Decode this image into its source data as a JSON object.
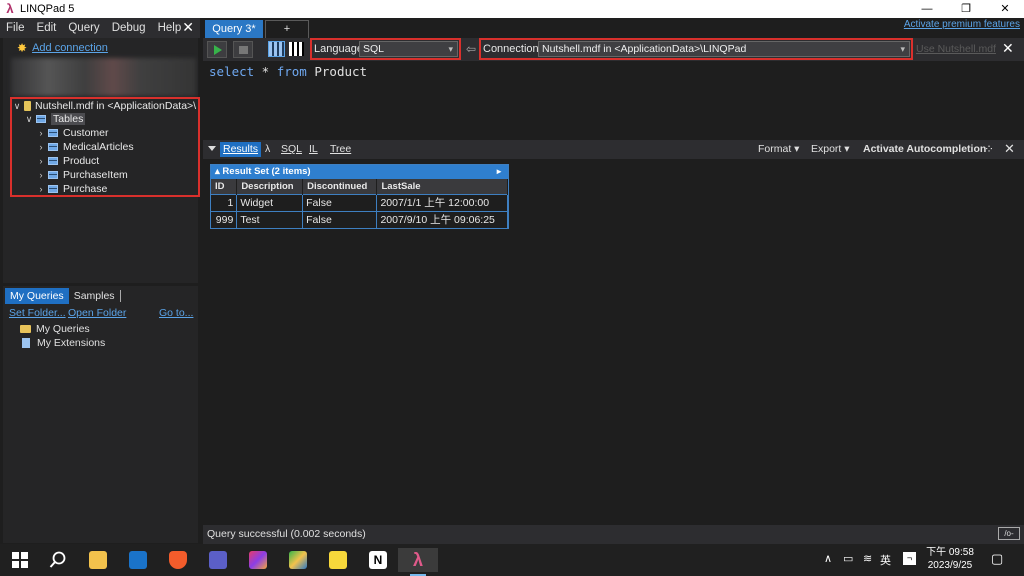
{
  "window": {
    "title": "LINQPad 5",
    "minimize": "—",
    "maximize": "❐",
    "close": "✕"
  },
  "menu": {
    "items": [
      "File",
      "Edit",
      "Query",
      "Debug",
      "Help"
    ],
    "close": "✕"
  },
  "connections": {
    "add_connection": "Add connection",
    "database": "Nutshell.mdf in <ApplicationData>\\",
    "tables_label": "Tables",
    "tables": [
      "Customer",
      "MedicalArticles",
      "Product",
      "PurchaseItem",
      "Purchase"
    ]
  },
  "queries_panel": {
    "tabs": [
      "My Queries",
      "Samples"
    ],
    "set_folder": "Set Folder...",
    "open_folder": "Open Folder",
    "go_to": "Go to...",
    "items": [
      "My Queries",
      "My Extensions"
    ]
  },
  "query_tabs": {
    "active": "Query 3*",
    "add": "+",
    "premium_link": "Activate premium features"
  },
  "toolbar": {
    "language_label": "Language",
    "language_value": "SQL",
    "connection_label": "Connection",
    "connection_value": "Nutshell.mdf in <ApplicationData>\\LINQPad",
    "use_link": "Use Nutshell.mdf",
    "close": "✕"
  },
  "editor": {
    "keyword1": "select",
    "star": " * ",
    "keyword2": "from",
    "table": " Product"
  },
  "results_bar": {
    "tabs": [
      "Results",
      "λ",
      "SQL",
      "IL",
      "Tree"
    ],
    "format": "Format ▾",
    "export": "Export ▾",
    "autocompletion": "Activate Autocompletion",
    "close": "✕"
  },
  "result_set": {
    "title": "Result Set (2 items)",
    "columns": [
      "ID",
      "Description",
      "Discontinued",
      "LastSale"
    ],
    "rows": [
      [
        "1",
        "Widget",
        "False",
        "2007/1/1 上午 12:00:00"
      ],
      [
        "999",
        "Test",
        "False",
        "2007/9/10 上午 09:06:25"
      ]
    ]
  },
  "status": {
    "text": "Query successful  (0.002 seconds)",
    "mode": "/o-"
  },
  "taskbar": {
    "tray_lang": "英",
    "time": "下午 09:58",
    "date": "2023/9/25"
  },
  "colors": {
    "accent": "#1f6fc2",
    "highlight_box": "#d9302c",
    "link": "#5ba4e8"
  }
}
